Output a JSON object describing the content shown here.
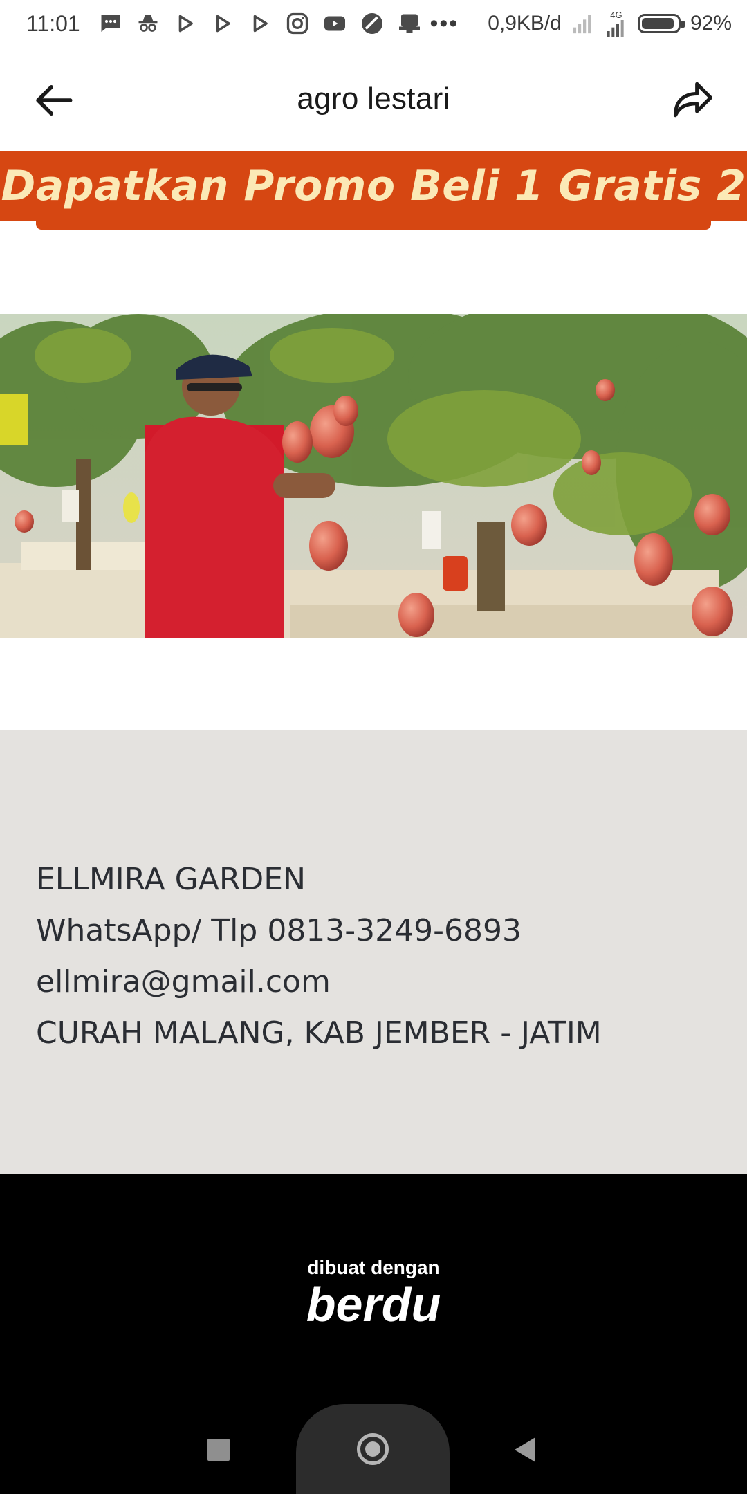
{
  "status_bar": {
    "time": "11:01",
    "network_speed": "0,9KB/d",
    "network_type": "4G",
    "battery": "92%",
    "battery_level": 0.92,
    "overflow": "•••",
    "notification_icons": [
      "message-icon",
      "incognito-icon",
      "play-store-icon",
      "play-store-icon",
      "play-store-icon",
      "instagram-icon",
      "youtube-icon",
      "app-icon",
      "printer-icon"
    ]
  },
  "app_bar": {
    "title": "agro lestari",
    "back_icon": "arrow-left-icon",
    "share_icon": "share-icon"
  },
  "promo": {
    "text": "Dapatkan Promo Beli 1 Gratis 2",
    "color": "#d64712",
    "text_color": "#fbe9b6"
  },
  "contact": {
    "lines": [
      "ELLMIRA GARDEN",
      "WhatsApp/ Tlp 0813-3249-6893",
      "ellmira@gmail.com",
      "CURAH MALANG, KAB JEMBER - JATIM"
    ]
  },
  "footer": {
    "made_with": "dibuat dengan",
    "brand": "berdu"
  },
  "nav": {
    "icons": [
      "recents-icon",
      "home-icon",
      "back-icon"
    ]
  }
}
